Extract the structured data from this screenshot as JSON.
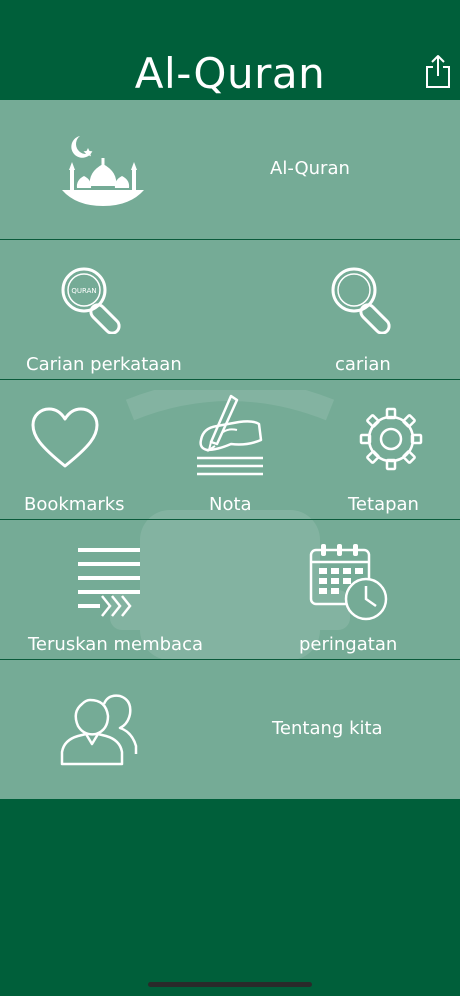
{
  "app": {
    "title": "Al-Quran"
  },
  "header": {
    "share_icon": "share-icon"
  },
  "menu": {
    "rows": [
      {
        "items": [
          {
            "label": "Al-Quran",
            "icon": "mosque-icon"
          }
        ]
      },
      {
        "items": [
          {
            "label": "Carian perkataan",
            "icon": "quran-search-icon",
            "icon_text": "QURAN"
          },
          {
            "label": "carian",
            "icon": "search-icon"
          }
        ]
      },
      {
        "items": [
          {
            "label": "Bookmarks",
            "icon": "heart-icon"
          },
          {
            "label": "Nota",
            "icon": "writing-hand-icon"
          },
          {
            "label": "Tetapan",
            "icon": "gear-icon"
          }
        ]
      },
      {
        "items": [
          {
            "label": "Teruskan membaca",
            "icon": "continue-reading-icon"
          },
          {
            "label": "peringatan",
            "icon": "calendar-clock-icon"
          }
        ]
      },
      {
        "items": [
          {
            "label": "Tentang kita",
            "icon": "users-icon"
          }
        ]
      }
    ]
  },
  "colors": {
    "header_bg": "#005f3a",
    "menu_bg": "#75ab96",
    "divider": "#0b5a3b",
    "text": "#ffffff"
  }
}
